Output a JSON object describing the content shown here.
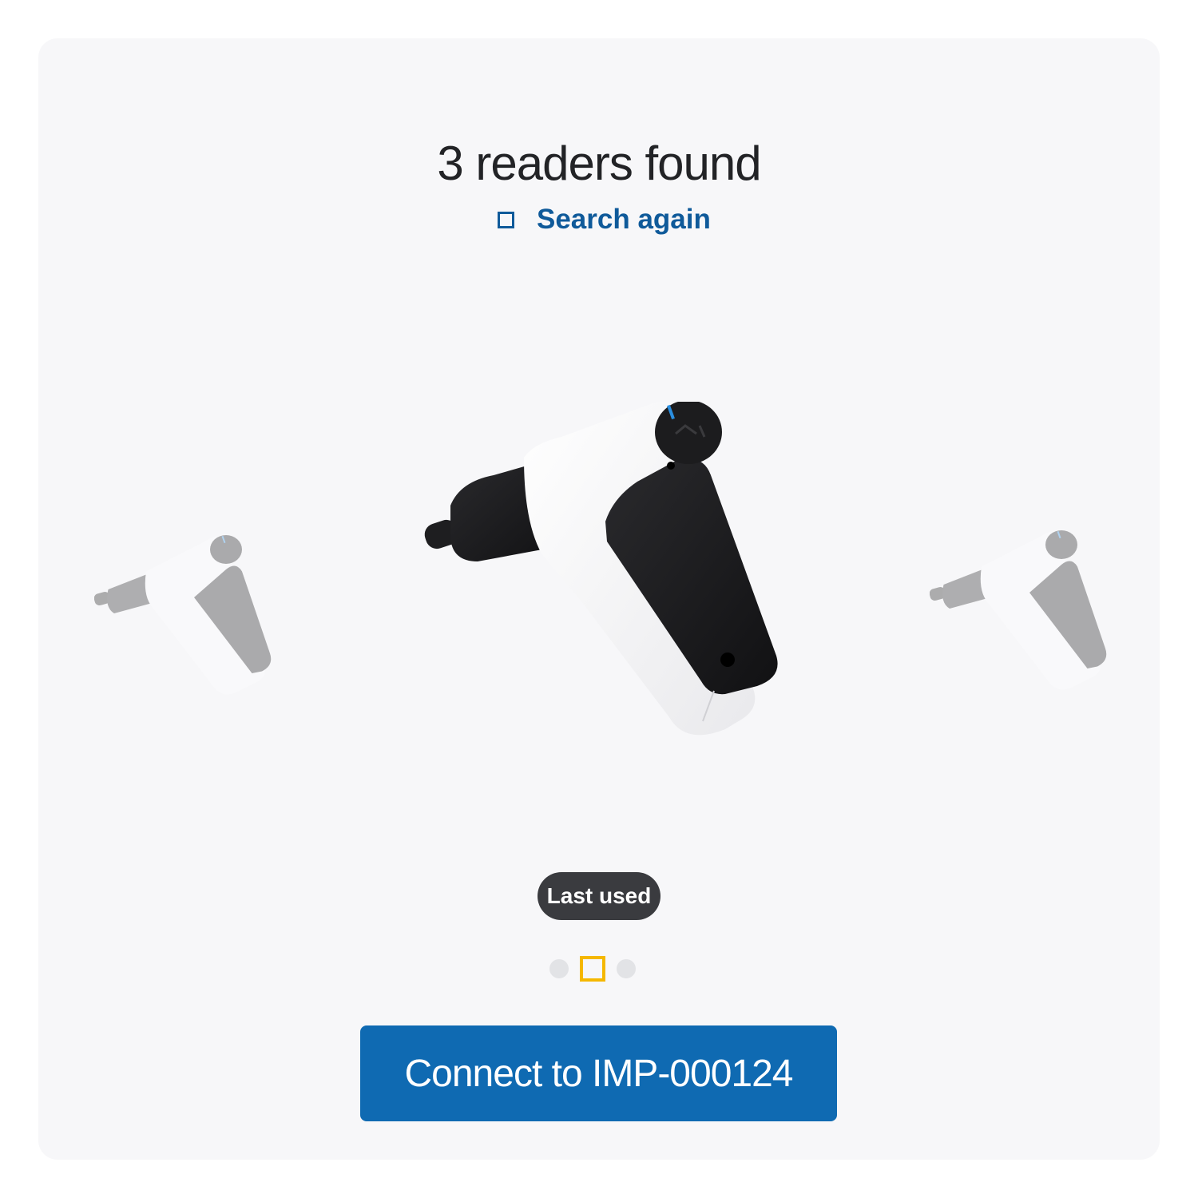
{
  "header": {
    "title": "3 readers found"
  },
  "search_again": {
    "label": "Search again",
    "icon": "square-outline-icon"
  },
  "carousel": {
    "readers": [
      {
        "name": "reader-previous",
        "state": "inactive"
      },
      {
        "name": "reader-current",
        "state": "active"
      },
      {
        "name": "reader-next",
        "state": "inactive"
      }
    ],
    "badge": "Last used",
    "active_index": 1,
    "count": 3
  },
  "actions": {
    "connect_label": "Connect to IMP-000124"
  },
  "colors": {
    "accent": "#0f6ab2",
    "link": "#0f5a9a",
    "badge_bg": "#3a3b3f",
    "active_dot": "#f5b800",
    "card_bg": "#f7f7f9"
  }
}
